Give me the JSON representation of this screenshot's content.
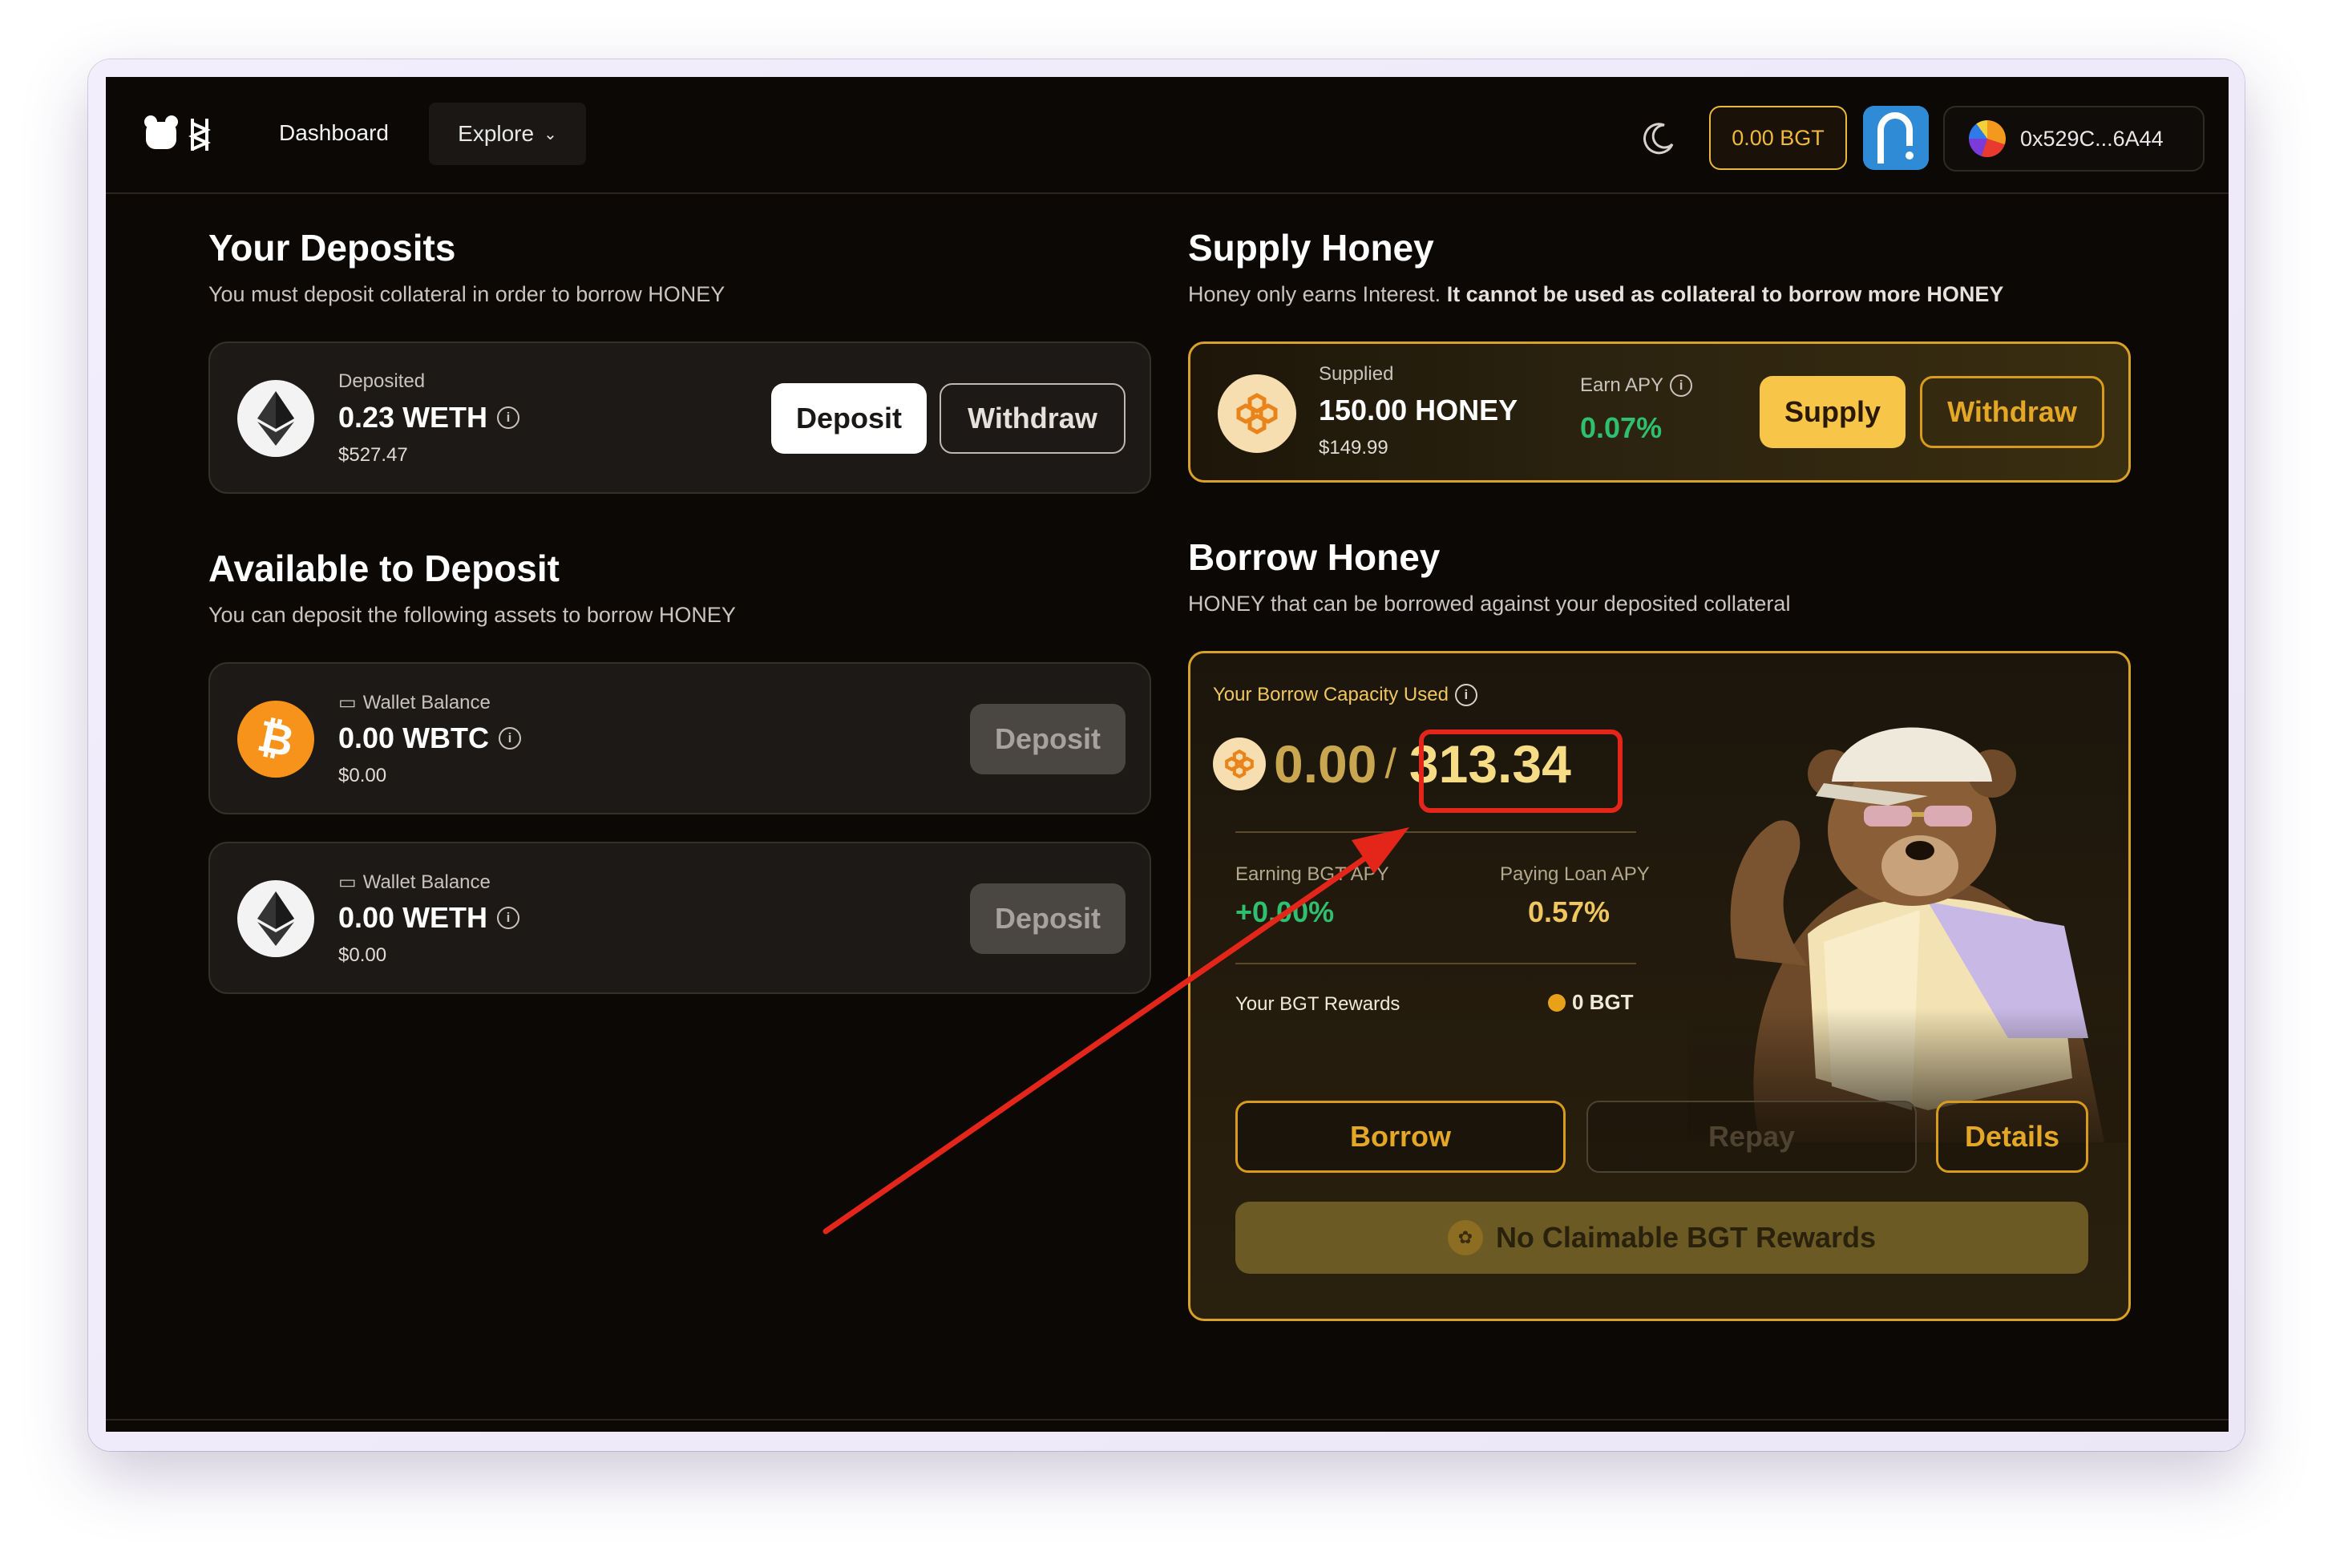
{
  "header": {
    "nav_dashboard": "Dashboard",
    "nav_explore": "Explore",
    "bgt_balance": "0.00 BGT",
    "wallet_address": "0x529C...6A44"
  },
  "deposits": {
    "title": "Your Deposits",
    "subtitle": "You must deposit collateral in order to borrow HONEY",
    "card": {
      "label": "Deposited",
      "amount": "0.23 WETH",
      "usd": "$527.47",
      "deposit_button": "Deposit",
      "withdraw_button": "Withdraw"
    }
  },
  "available": {
    "title": "Available to Deposit",
    "subtitle": "You can deposit the following assets to borrow HONEY",
    "items": [
      {
        "label": "Wallet Balance",
        "amount": "0.00 WBTC",
        "usd": "$0.00",
        "button": "Deposit",
        "icon": "bitcoin-icon"
      },
      {
        "label": "Wallet Balance",
        "amount": "0.00 WETH",
        "usd": "$0.00",
        "button": "Deposit",
        "icon": "ethereum-icon"
      }
    ]
  },
  "supply": {
    "title": "Supply Honey",
    "subtitle_plain": "Honey only earns Interest.",
    "subtitle_bold": "It cannot be used as collateral to borrow more HONEY",
    "supplied_label": "Supplied",
    "supplied_amount": "150.00 HONEY",
    "supplied_usd": "$149.99",
    "apy_label": "Earn APY",
    "apy_value": "0.07%",
    "supply_button": "Supply",
    "withdraw_button": "Withdraw"
  },
  "borrow": {
    "title": "Borrow Honey",
    "subtitle": "HONEY that can be borrowed against your deposited collateral",
    "capacity_label": "Your Borrow Capacity Used",
    "capacity_used": "0.00",
    "separator": "/",
    "capacity_total": "313.34",
    "earning_label": "Earning BGT APY",
    "earning_value": "+0.00%",
    "paying_label": "Paying Loan APY",
    "paying_value": "0.57%",
    "rewards_label": "Your BGT Rewards",
    "rewards_value": "0 BGT",
    "borrow_button": "Borrow",
    "repay_button": "Repay",
    "details_button": "Details",
    "claim_label": "No Claimable BGT Rewards"
  },
  "colors": {
    "accent_gold": "#f0c75e",
    "apy_green": "#2fbf6f",
    "annotation_red": "#e4261a"
  }
}
